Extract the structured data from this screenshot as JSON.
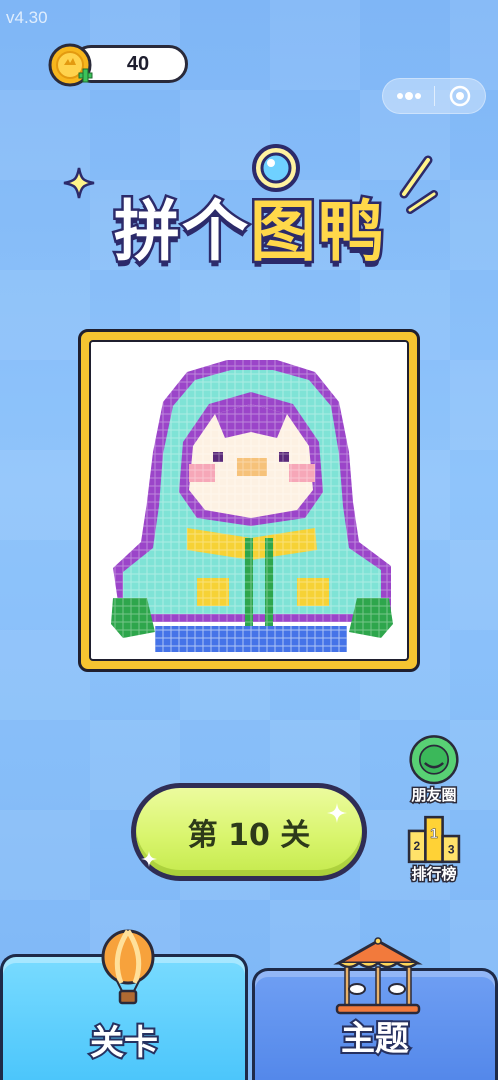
{
  "version": "v4.30",
  "coins": {
    "count": "40"
  },
  "title": {
    "part1": "拼个",
    "part2": "图鸭"
  },
  "level": {
    "label": "第 10 关"
  },
  "side_buttons": {
    "moments_label": "朋友圈",
    "ranking_label": "排行榜",
    "ranking_ranks": [
      "2",
      "1",
      "3"
    ]
  },
  "tabs": {
    "levels_label": "关卡",
    "themes_label": "主题"
  },
  "colors": {
    "coin_gold": "#f6c431",
    "level_button": "#d9f56d",
    "tab_active": "#4cc6fb",
    "tab_inactive": "#5488ea"
  }
}
